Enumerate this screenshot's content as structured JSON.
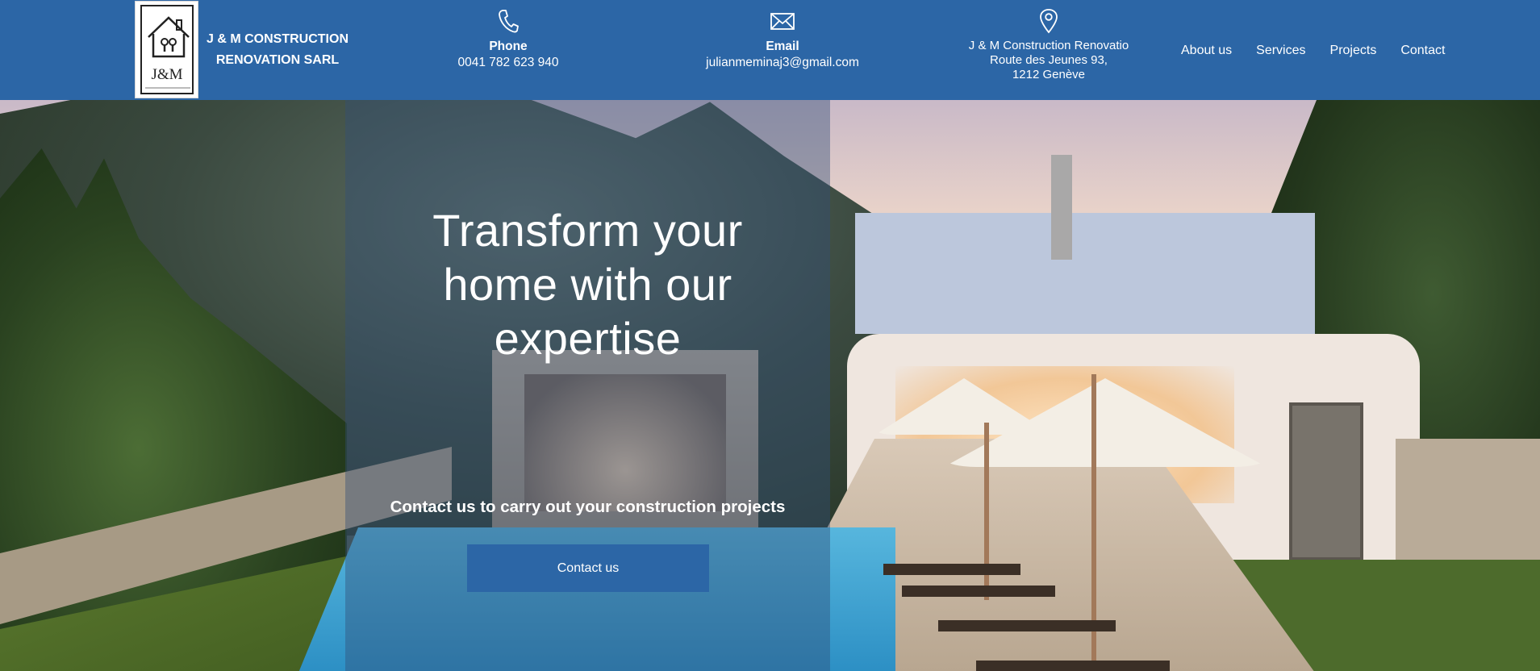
{
  "brand": {
    "logo_text": "J&M",
    "logo_tagline": "construction renovation sàrl",
    "company_line1": "J & M CONSTRUCTION",
    "company_line2": "RENOVATION SARL"
  },
  "contacts": {
    "phone": {
      "icon": "phone-icon",
      "title": "Phone",
      "value": "0041 782 623 940"
    },
    "email": {
      "icon": "envelope-icon",
      "title": "Email",
      "value": "julianmeminaj3@gmail.com"
    },
    "address": {
      "icon": "map-pin-icon",
      "line1": "J & M Construction Renovatio",
      "line2": "Route des Jeunes 93,",
      "line3": "1212 Genève"
    }
  },
  "nav": {
    "items": [
      "About us",
      "Services",
      "Projects",
      "Contact"
    ]
  },
  "hero": {
    "title_line1": "Transform your",
    "title_line2": "home with our",
    "title_line3": "expertise",
    "subtitle": "Contact us to carry out your construction projects",
    "cta_label": "Contact us"
  },
  "colors": {
    "primary": "#2c66a6",
    "text_on_primary": "#ffffff"
  }
}
